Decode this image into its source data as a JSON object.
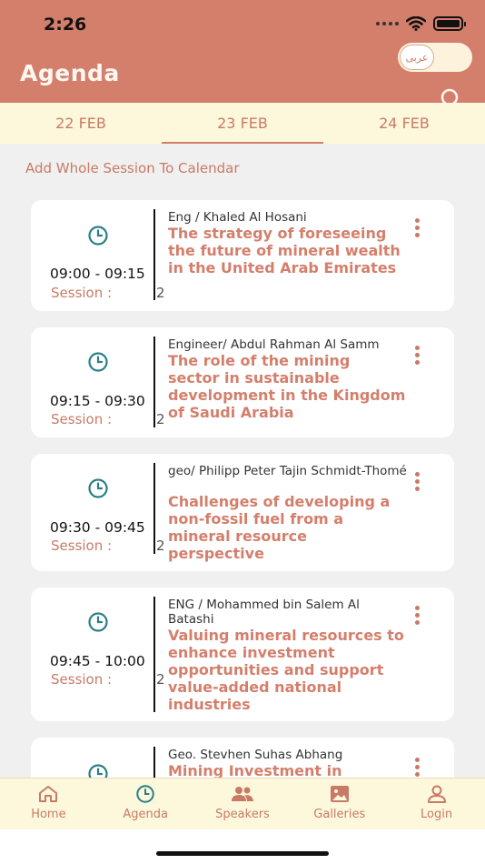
{
  "status_bar": {
    "time": "2:26"
  },
  "header": {
    "title": "Agenda",
    "lang_toggle": "عربى"
  },
  "date_tabs": [
    {
      "label": "22 FEB"
    },
    {
      "label": "23 FEB"
    },
    {
      "label": "24 FEB"
    }
  ],
  "add_session_label": "Add Whole Session To Calendar",
  "session_label": "Session :",
  "sessions": [
    {
      "time": "09:00 - 09:15",
      "session": "2",
      "speaker": "Eng / Khaled Al Hosani",
      "title": "The strategy of foreseeing the future of mineral wealth in the United Arab Emirates"
    },
    {
      "time": "09:15 - 09:30",
      "session": "2",
      "speaker": "Engineer/ Abdul Rahman Al Samm",
      "title": "The role of the mining sector in sustainable development in the Kingdom of Saudi Arabia"
    },
    {
      "time": "09:30 - 09:45",
      "session": "2",
      "speaker": "geo/  Philipp Peter Tajin Schmidt-Thomé",
      "title": "Challenges of developing a non-fossil fuel from a mineral resource perspective"
    },
    {
      "time": "09:45 - 10:00",
      "session": "2",
      "speaker": "ENG / Mohammed bin Salem Al Batashi",
      "title": "Valuing mineral resources to enhance investment opportunities and support value-added national industries"
    },
    {
      "time": "",
      "session": "",
      "speaker": "Geo. Stevhen Suhas Abhang",
      "title": "Mining Investment in"
    }
  ],
  "bottom_nav": [
    {
      "label": "Home",
      "icon": "home-icon"
    },
    {
      "label": "Agenda",
      "icon": "clock-icon"
    },
    {
      "label": "Speakers",
      "icon": "people-icon"
    },
    {
      "label": "Galleries",
      "icon": "image-icon"
    },
    {
      "label": "Login",
      "icon": "person-icon"
    }
  ],
  "colors": {
    "header": "#d47f6c",
    "tab_bg": "#fdf8dc",
    "accent": "#c97a66",
    "clock": "#2a7f86"
  }
}
